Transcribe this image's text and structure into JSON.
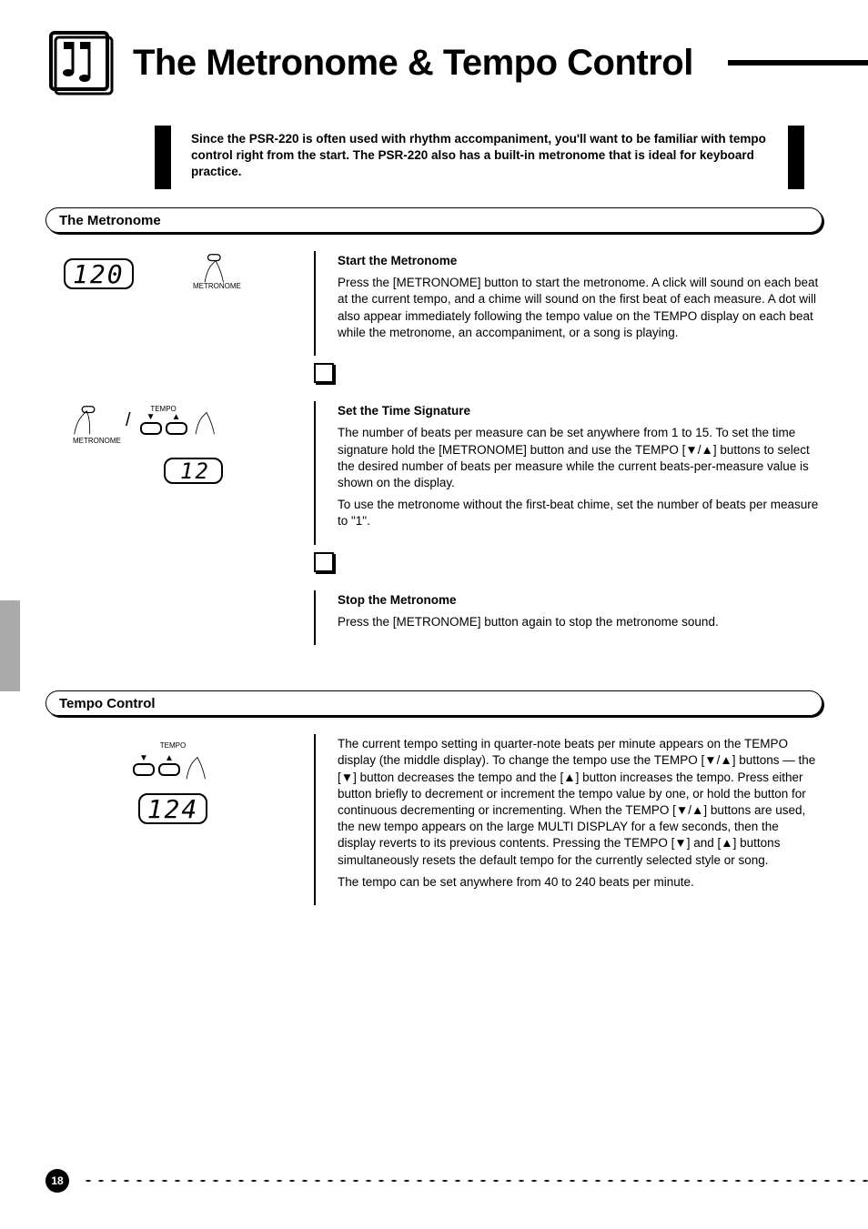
{
  "header": {
    "title": "The Metronome & Tempo Control"
  },
  "intro": "Since the PSR-220 is often used with rhythm accompaniment, you'll want to be familiar with tempo control right from the start. The PSR-220 also has a built-in metronome that is ideal for keyboard practice.",
  "sections": {
    "metronome_title": "The Metronome",
    "tempo_title": "Tempo Control"
  },
  "steps": {
    "s1": {
      "label": "Start the Metronome",
      "text": "Press the [METRONOME] button to start the metronome. A click will sound on each beat at the current tempo, and a chime will sound on the first beat of each measure. A dot will also appear immediately following the tempo value on the TEMPO display on each beat while the metronome, an accompaniment, or a song is playing.",
      "lcd": "120",
      "btn_label": "METRONOME"
    },
    "s2": {
      "label": "Set the Time Signature",
      "text1": "The number of beats per measure can be set anywhere from 1 to 15. To set the time signature hold the [METRONOME] button and use the TEMPO [▼/▲] buttons to select the desired number of beats per measure while the current beats-per-measure value is shown on the display.",
      "text2": "To use the metronome without the first-beat chime, set the number of beats per measure to \"1\".",
      "lcd": "12",
      "btn_label": "METRONOME",
      "tempo_label": "TEMPO"
    },
    "s3": {
      "label": "Stop the Metronome",
      "text": "Press the [METRONOME] button again to stop the metronome sound."
    },
    "tempo": {
      "text1": "The current tempo setting in quarter-note beats per minute appears on the TEMPO display (the middle display). To change the tempo use the TEMPO [▼/▲] buttons — the [▼] button decreases the tempo and the [▲] button increases the tempo. Press either button briefly to decrement or increment the tempo value by one, or hold the button for continuous decrementing or incrementing. When the TEMPO [▼/▲] buttons are used, the new tempo appears on the large MULTI DISPLAY for a few seconds, then the display reverts to its previous contents. Pressing the TEMPO [▼] and [▲] buttons simultaneously resets the default tempo for the currently selected style or song.",
      "text2": "The tempo can be set anywhere from 40 to 240 beats per minute.",
      "lcd": "124",
      "tempo_label": "TEMPO"
    }
  },
  "pagenum": "18"
}
